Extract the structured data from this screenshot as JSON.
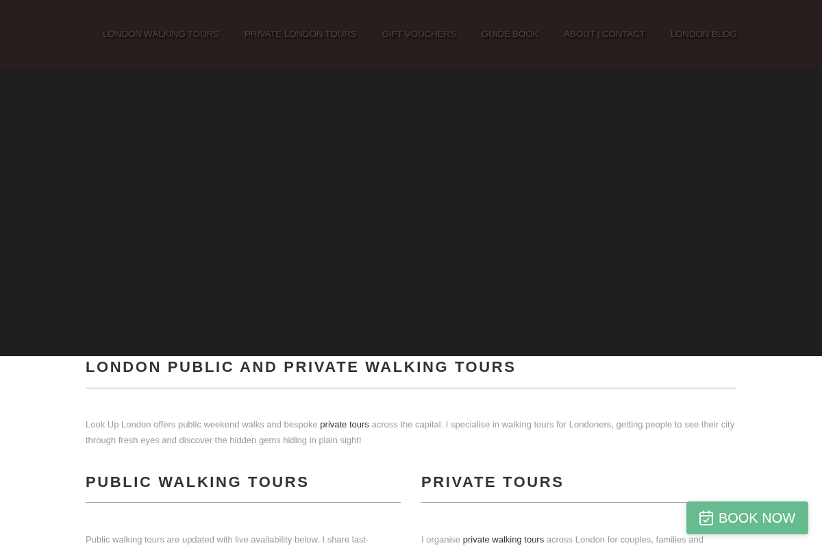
{
  "nav": {
    "items": [
      {
        "label": "LONDON WALKING TOURS"
      },
      {
        "label": "PRIVATE LONDON TOURS"
      },
      {
        "label": "GIFT VOUCHERS"
      },
      {
        "label": "GUIDE BOOK"
      },
      {
        "label": "ABOUT | CONTACT"
      },
      {
        "label": "LONDON BLOG"
      }
    ]
  },
  "intro": {
    "title": "LONDON PUBLIC AND PRIVATE WALKING TOURS",
    "body": [
      {
        "kind": "text",
        "text": "Look Up London offers public weekend walks and bespoke "
      },
      {
        "kind": "link",
        "text": "private tours"
      },
      {
        "kind": "text",
        "text": " across the capital. I specialise in walking tours for Londoners, getting people to see their city through fresh eyes and discover the hidden gems hiding in plain sight!"
      }
    ]
  },
  "sections": [
    {
      "title": "PUBLIC WALKING TOURS",
      "body": [
        {
          "kind": "text",
          "text": "Public walking tours are updated with live availability below. I share last-"
        }
      ]
    },
    {
      "title": "PRIVATE TOURS",
      "body": [
        {
          "kind": "text",
          "text": "I organise "
        },
        {
          "kind": "link",
          "text": "private walking tours"
        },
        {
          "kind": "text",
          "text": " across London for couples, families and"
        }
      ]
    }
  ],
  "book_button": {
    "label": "BOOK NOW"
  }
}
